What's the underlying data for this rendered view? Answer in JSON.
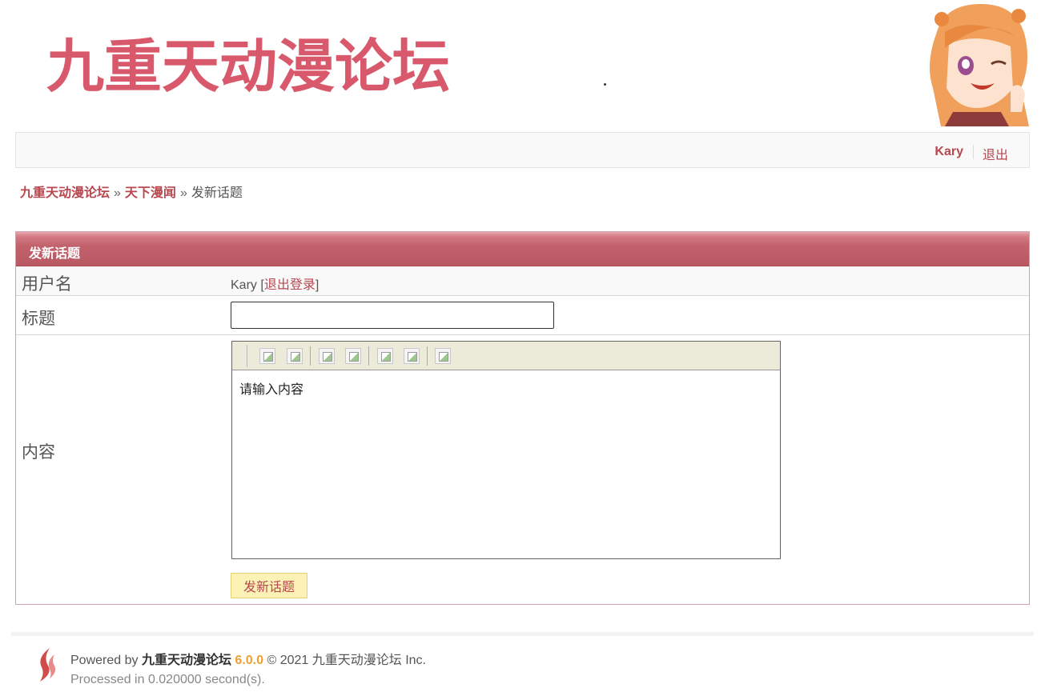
{
  "header": {
    "logo_text": "九重天动漫论坛"
  },
  "userbar": {
    "username": "Kary",
    "logout": "退出"
  },
  "breadcrumb": {
    "home": "九重天动漫论坛",
    "sep": "»",
    "forum": "天下漫闻",
    "current": "发新话题"
  },
  "form": {
    "title": "发新话题",
    "user_label": "用户名",
    "user_value": "Kary",
    "user_logout": "退出登录",
    "bracket_open": "[",
    "bracket_close": "]",
    "subject_label": "标题",
    "subject_value": "",
    "content_label": "内容",
    "content_placeholder": "请输入内容",
    "toolbar_icons": [
      "bold-icon",
      "italic-icon",
      "link-icon",
      "unlink-icon",
      "image-icon",
      "quote-icon",
      "code-icon"
    ],
    "submit_label": "发新话题"
  },
  "footer": {
    "powered_by": "Powered by",
    "brand": "九重天动漫论坛",
    "version": "6.0.0",
    "copyright": "© 2021 九重天动漫论坛 Inc.",
    "processed": "Processed in 0.020000 second(s)."
  },
  "colors": {
    "accent": "#b8474f",
    "title_bar": "#c2606b",
    "submit_bg": "#fdf2b5",
    "version": "#f0a030"
  }
}
